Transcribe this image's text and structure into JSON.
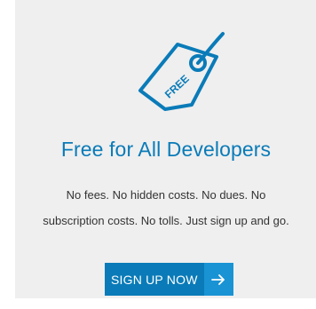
{
  "promo": {
    "tag_text": "FREE",
    "title": "Free for All Developers",
    "description_line1": "No fees. No hidden costs. No dues. No",
    "description_line2": "subscription costs. No tolls. Just sign up and go.",
    "cta_label": "SIGN UP NOW",
    "cta_icon": "arrow-right-icon",
    "tag_icon": "price-tag-icon"
  },
  "colors": {
    "accent": "#0a7bb8",
    "accent_light": "#1a93d4",
    "card_background": "#efefef",
    "body_text": "#333333"
  }
}
